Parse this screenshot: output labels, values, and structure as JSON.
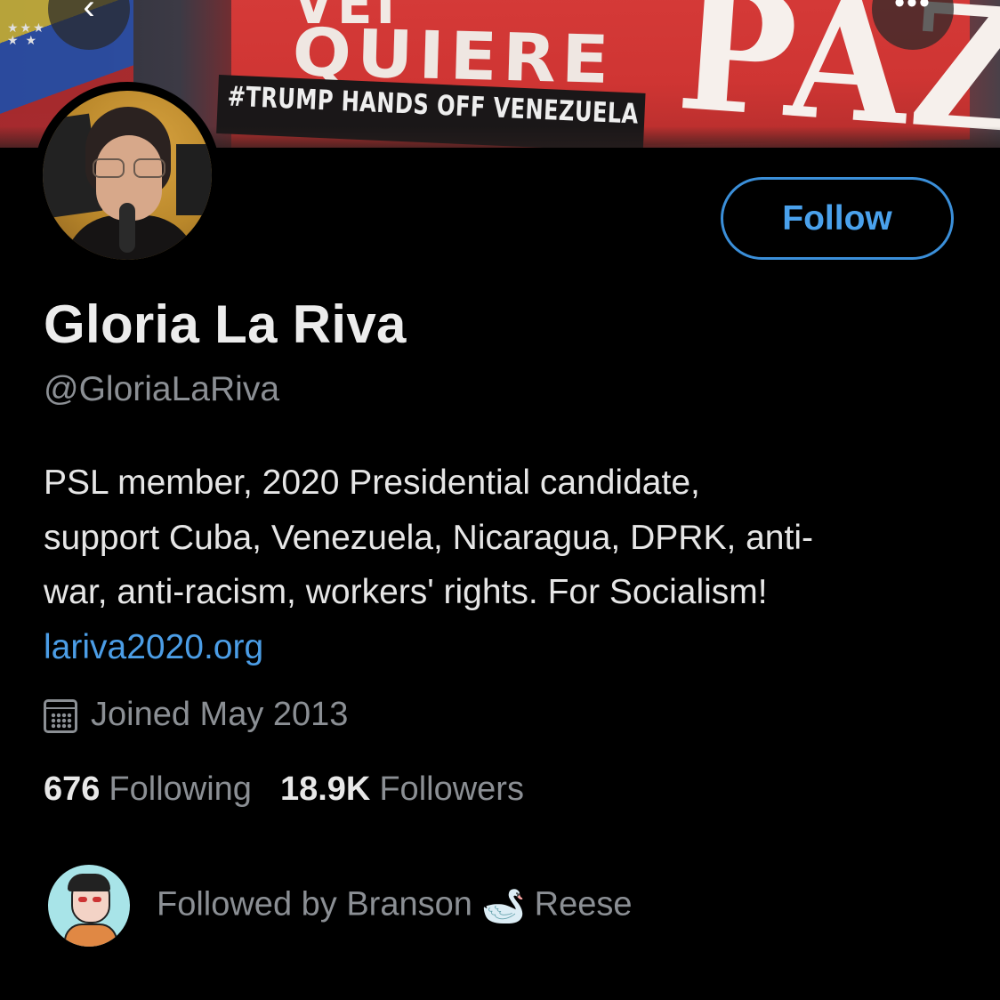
{
  "header": {
    "banner_text_top": "QUIERE",
    "banner_text_big": "PAZ",
    "banner_hashtag": "#TRUMP HANDS OFF VENEZUELA",
    "back_icon": "chevron-left-icon",
    "more_icon": "ellipsis-icon"
  },
  "profile": {
    "display_name": "Gloria La Riva",
    "handle": "@GloriaLaRiva",
    "follow_label": "Follow",
    "bio_lines": [
      "PSL member, 2020 Presidential candidate,",
      "support Cuba, Venezuela, Nicaragua, DPRK, anti-",
      "war, anti-racism, workers' rights. For Socialism!"
    ],
    "bio_link": "lariva2020.org",
    "joined": "Joined May 2013",
    "following_count": "676",
    "following_label": "Following",
    "followers_count": "18.9K",
    "followers_label": "Followers",
    "followed_by_prefix": "Followed by Branson",
    "followed_by_emoji": "🦢",
    "followed_by_suffix": "Reese"
  },
  "colors": {
    "accent": "#4aa1ec",
    "background": "#000000",
    "secondary_text": "#8b8f94"
  }
}
